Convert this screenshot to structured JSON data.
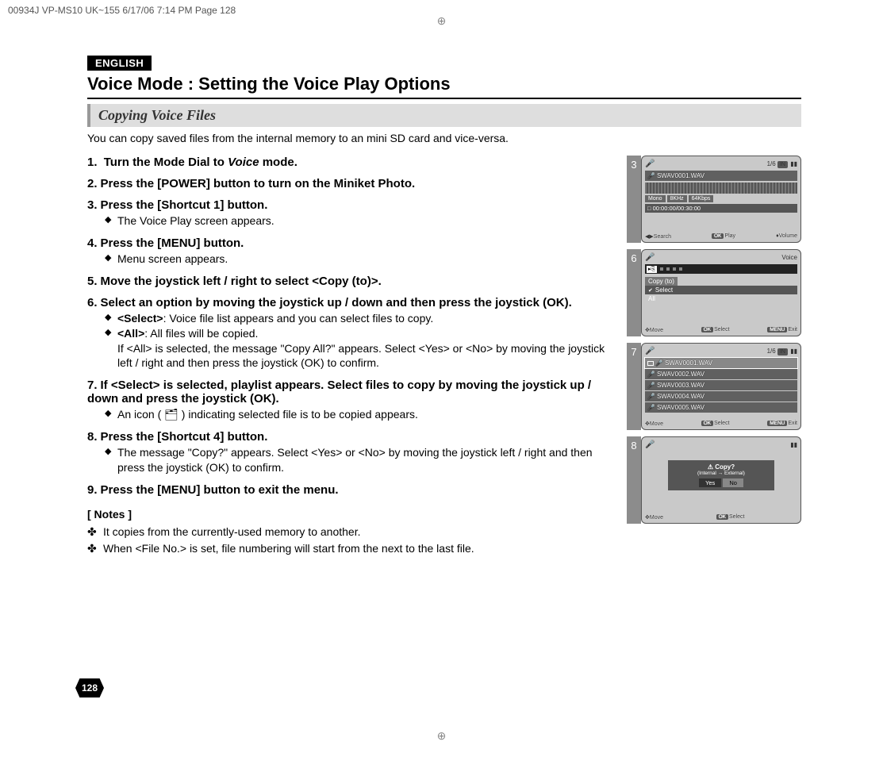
{
  "crop_header": "00934J VP-MS10 UK~155  6/17/06 7:14 PM  Page 128",
  "language_tag": "ENGLISH",
  "title": "Voice Mode : Setting the Voice Play Options",
  "subtitle": "Copying Voice Files",
  "intro": "You can copy saved files from the internal memory to an mini SD card and vice-versa.",
  "steps": [
    {
      "num": "1.",
      "text_pre": "Turn the Mode Dial to ",
      "text_italic": "Voice",
      "text_post": " mode."
    },
    {
      "num": "2.",
      "text": "Press the [POWER] button to turn on the Miniket Photo."
    },
    {
      "num": "3.",
      "text": "Press the [Shortcut 1] button.",
      "bullets": [
        {
          "text": "The Voice Play screen appears."
        }
      ]
    },
    {
      "num": "4.",
      "text": "Press the [MENU] button.",
      "bullets": [
        {
          "text": "Menu screen appears."
        }
      ]
    },
    {
      "num": "5.",
      "text": "Move the joystick left / right to select <Copy (to)>."
    },
    {
      "num": "6.",
      "text": "Select an option by moving the joystick up / down and then press the joystick (OK).",
      "bullets": [
        {
          "bold": "<Select>",
          "text": ": Voice file list appears and you can select files to copy."
        },
        {
          "bold": "<All>",
          "text": ": All files will be copied.",
          "cont": "If <All> is selected, the message \"Copy All?\" appears. Select <Yes> or <No> by moving the joystick left / right and then press the joystick (OK) to confirm."
        }
      ]
    },
    {
      "num": "7.",
      "text": "If <Select> is selected, playlist appears. Select files to copy by moving the joystick up / down and press the joystick (OK).",
      "bullets": [
        {
          "text": "An icon (  🗂  ) indicating selected file is to be copied appears."
        }
      ]
    },
    {
      "num": "8.",
      "text": "Press the [Shortcut 4] button.",
      "bullets": [
        {
          "text": "The message \"Copy?\" appears. Select <Yes> or <No> by moving the joystick left / right and then press the joystick (OK) to confirm."
        }
      ]
    },
    {
      "num": "9.",
      "text": "Press the [MENU] button to exit the menu."
    }
  ],
  "notes_heading": "[ Notes ]",
  "notes": [
    "It copies from the currently-used memory to another.",
    "When <File No.> is set, file numbering will start from the next to the last file."
  ],
  "page_number": "128",
  "screens": {
    "s3": {
      "step": "3",
      "counter": "1/6",
      "storage": "IN",
      "filename": "SWAV0001.WAV",
      "tags": [
        "Mono",
        "8KHz",
        "64Kbps"
      ],
      "time": "00:00:00/00:30:00",
      "hint_search": "Search",
      "hint_ok": "OK",
      "hint_play": "Play",
      "hint_vol": "Volume"
    },
    "s6": {
      "step": "6",
      "title": "Voice",
      "menu": "Copy (to)",
      "opt_select": "Select",
      "opt_all": "All",
      "hint_move": "Move",
      "hint_ok": "OK",
      "hint_select": "Select",
      "hint_menu": "MENU",
      "hint_exit": "Exit"
    },
    "s7": {
      "step": "7",
      "counter": "1/6",
      "storage": "IN",
      "files": [
        "SWAV0001.WAV",
        "SWAV0002.WAV",
        "SWAV0003.WAV",
        "SWAV0004.WAV",
        "SWAV0005.WAV"
      ],
      "hint_move": "Move",
      "hint_ok": "OK",
      "hint_select": "Select",
      "hint_menu": "MENU",
      "hint_exit": "Exit"
    },
    "s8": {
      "step": "8",
      "dialog_q": "Copy?",
      "dialog_sub": "(Internal → External)",
      "yes": "Yes",
      "no": "No",
      "hint_move": "Move",
      "hint_ok": "OK",
      "hint_select": "Select"
    }
  }
}
